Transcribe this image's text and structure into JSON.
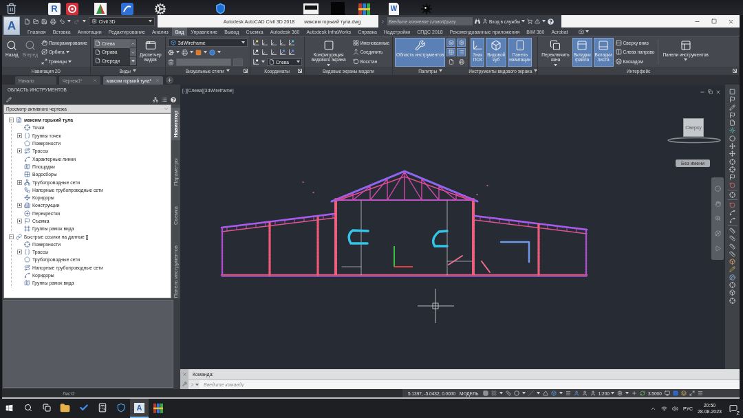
{
  "desktop": {
    "icons": [
      {
        "kind": "bin"
      },
      {
        "kind": "letter_tile",
        "letter": "R"
      },
      {
        "kind": "ring"
      },
      {
        "kind": "triangle_tile"
      },
      {
        "kind": "arrow_tile"
      },
      {
        "kind": "cog"
      },
      {
        "kind": "shield"
      },
      {
        "kind": "monitor"
      },
      {
        "kind": "dark_tile"
      },
      {
        "kind": "books"
      },
      {
        "kind": "document",
        "letter": "W"
      },
      {
        "kind": "spiked_ball"
      }
    ]
  },
  "window": {
    "logo": "A",
    "workspace": "Civil 3D",
    "title": "Autodesk AutoCAD Civil 3D 2018",
    "file": "максим горький тула.dwg",
    "search": {
      "placeholder": "Введите ключевое слово/фразу"
    },
    "sign_in": "Вход в службы"
  },
  "ribbon_tabs": [
    {
      "label": "Главная",
      "selected": false
    },
    {
      "label": "Вставка",
      "selected": false
    },
    {
      "label": "Аннотации",
      "selected": false
    },
    {
      "label": "Редактирование",
      "selected": false
    },
    {
      "label": "Анализ",
      "selected": false
    },
    {
      "label": "Вид",
      "selected": true
    },
    {
      "label": "Управление",
      "selected": false
    },
    {
      "label": "Вывод",
      "selected": false
    },
    {
      "label": "Съемка",
      "selected": false
    },
    {
      "label": "Autodesk 360",
      "selected": false
    },
    {
      "label": "Autodesk InfraWorks",
      "selected": false
    },
    {
      "label": "Справка",
      "selected": false
    },
    {
      "label": "Надстройки",
      "selected": false
    },
    {
      "label": "СПДС 2018",
      "selected": false
    },
    {
      "label": "Рекомендованные приложения",
      "selected": false
    },
    {
      "label": "BIM 360",
      "selected": false
    },
    {
      "label": "Acrobat",
      "selected": false
    }
  ],
  "ribbon_panels": [
    {
      "title": "Навигация 2D",
      "menu": false,
      "launcher": false,
      "columns": [
        {
          "kind": "large",
          "label": "Назад",
          "active": false,
          "disabled": false,
          "dropdown": false
        },
        {
          "kind": "large",
          "label": "Вперед",
          "active": false,
          "disabled": true,
          "dropdown": false
        },
        {
          "kind": "stack",
          "items": [
            {
              "label": "Панорамирование",
              "dropdown": false
            },
            {
              "label": "Орбита",
              "dropdown": true
            },
            {
              "label": "Границы",
              "dropdown": true
            }
          ]
        }
      ]
    },
    {
      "title": "Виды",
      "menu": true,
      "launcher": false,
      "columns": [
        {
          "kind": "list",
          "entries": [
            {
              "label": "Слева",
              "selected": true
            },
            {
              "label": "Справа",
              "selected": false
            },
            {
              "label": "Спереди",
              "selected": false
            }
          ]
        },
        {
          "kind": "large",
          "label": "Диспетчер видов",
          "active": false,
          "disabled": false,
          "dropdown": false
        }
      ]
    },
    {
      "title": "Визуальные стили",
      "menu": true,
      "launcher": true,
      "columns": [
        {
          "kind": "style_select",
          "value": "3dWireframe"
        }
      ]
    },
    {
      "title": "Координаты",
      "menu": false,
      "launcher": true,
      "columns": [
        {
          "kind": "coords",
          "value": "Слева"
        }
      ]
    },
    {
      "title": "Видовые экраны модели",
      "menu": false,
      "launcher": false,
      "columns": [
        {
          "kind": "large",
          "label": "Конфигурация видового экрана",
          "active": false,
          "disabled": false,
          "dropdown": true
        },
        {
          "kind": "stack",
          "items": [
            {
              "label": "Именованные",
              "dropdown": false
            },
            {
              "label": "Соединить",
              "dropdown": false
            },
            {
              "label": "Восстан",
              "dropdown": false
            }
          ]
        }
      ]
    },
    {
      "title": "Палитры",
      "menu": true,
      "launcher": false,
      "columns": [
        {
          "kind": "large",
          "label": "Область инструментов",
          "active": true,
          "disabled": false,
          "dropdown": false
        },
        {
          "kind": "icon_grid",
          "tiles": [
            {
              "active": true
            },
            {
              "active": true
            },
            {
              "active": true
            },
            {
              "active": true
            },
            {
              "active": false
            },
            {
              "active": false
            }
          ]
        }
      ]
    },
    {
      "title": "Инструменты видового экрана",
      "menu": true,
      "launcher": false,
      "columns": [
        {
          "kind": "large",
          "label": "Знак ПСК",
          "active": true,
          "disabled": false,
          "dropdown": false
        },
        {
          "kind": "large",
          "label": "Видовой куб",
          "active": true,
          "disabled": false,
          "dropdown": false
        },
        {
          "kind": "large",
          "label": "Панель навигации",
          "active": true,
          "disabled": false,
          "dropdown": false
        }
      ]
    },
    {
      "title": "Интерфейс",
      "menu": false,
      "launcher": true,
      "columns": [
        {
          "kind": "large",
          "label": "Переключить окна",
          "active": false,
          "disabled": false,
          "dropdown": true
        },
        {
          "kind": "large",
          "label": "Вкладки файла",
          "active": true,
          "disabled": false,
          "dropdown": false
        },
        {
          "kind": "large",
          "label": "Вкладки листа",
          "active": true,
          "disabled": false,
          "dropdown": false
        },
        {
          "kind": "stack",
          "items": [
            {
              "label": "Сверху вниз",
              "dropdown": false
            },
            {
              "label": "Слева направо",
              "dropdown": false
            },
            {
              "label": "Каскадом",
              "dropdown": false
            }
          ]
        },
        {
          "kind": "large",
          "label": "Панели инструментов",
          "active": false,
          "disabled": false,
          "dropdown": true
        }
      ]
    }
  ],
  "file_tabs": [
    {
      "label": "Начало",
      "selected": false
    },
    {
      "label": "Чертеж1*",
      "selected": false
    },
    {
      "label": "максим горький тула*",
      "selected": true
    }
  ],
  "tool_palette": {
    "title": "ОБЛАСТЬ ИНСТРУМЕНТОВ",
    "view": "Просмотр активного чертежа",
    "tree": [
      {
        "label": "максим горький тула",
        "active": true,
        "expanded": true,
        "children": [
          {
            "label": "Точки"
          },
          {
            "label": "Группы точек",
            "expanded": false
          },
          {
            "label": "Поверхности"
          },
          {
            "label": "Трассы",
            "expanded": false
          },
          {
            "label": "Характерные линии"
          },
          {
            "label": "Площадки"
          },
          {
            "label": "Водосборы"
          },
          {
            "label": "Трубопроводные сети",
            "expanded": false
          },
          {
            "label": "Напорные трубопроводные сети"
          },
          {
            "label": "Коридоры"
          },
          {
            "label": "Конструкции",
            "expanded": false
          },
          {
            "label": "Перекрестки"
          },
          {
            "label": "Съемка",
            "expanded": false
          },
          {
            "label": "Группы рамок вида"
          }
        ]
      },
      {
        "label": "Быстрые ссылки на данные []",
        "active": false,
        "expanded": true,
        "children": [
          {
            "label": "Поверхности"
          },
          {
            "label": "Трассы",
            "expanded": false
          },
          {
            "label": "Трубопроводные сети"
          },
          {
            "label": "Напорные трубопроводные сети"
          },
          {
            "label": "Коридоры"
          },
          {
            "label": "Группы рамок вида"
          }
        ]
      }
    ],
    "side_tabs": [
      {
        "label": "Навигатор",
        "selected": true
      },
      {
        "label": "Параметры",
        "selected": false
      },
      {
        "label": "Съемка",
        "selected": false
      },
      {
        "label": "Панель инструментов",
        "selected": false
      }
    ]
  },
  "viewport": {
    "label": "[-][Слева][3dWireframe]",
    "viewcube": "Сверху",
    "view_name": "Без имени"
  },
  "command_line": {
    "prompt": "Команда:",
    "placeholder": "Введите команду"
  },
  "status_bar": {
    "layout_tabs": [
      {
        "label": "Лист2",
        "selected": false
      }
    ],
    "coordinates": "5.1397, -5.0432, 0.0000",
    "space": "МОДЕЛЬ",
    "scale": "1:200",
    "value_field": "3.5000"
  },
  "taskbar": {
    "apps": [
      {
        "kind": "folder",
        "selected": false
      },
      {
        "kind": "check",
        "selected": false
      },
      {
        "kind": "calculator",
        "selected": false
      },
      {
        "kind": "shield",
        "selected": false
      },
      {
        "kind": "letter_tile",
        "letter": "A",
        "selected": true
      },
      {
        "kind": "books",
        "selected": false
      }
    ],
    "language": "РУС",
    "time": "20:50",
    "date": "28.08.2023",
    "notifications": "2"
  }
}
